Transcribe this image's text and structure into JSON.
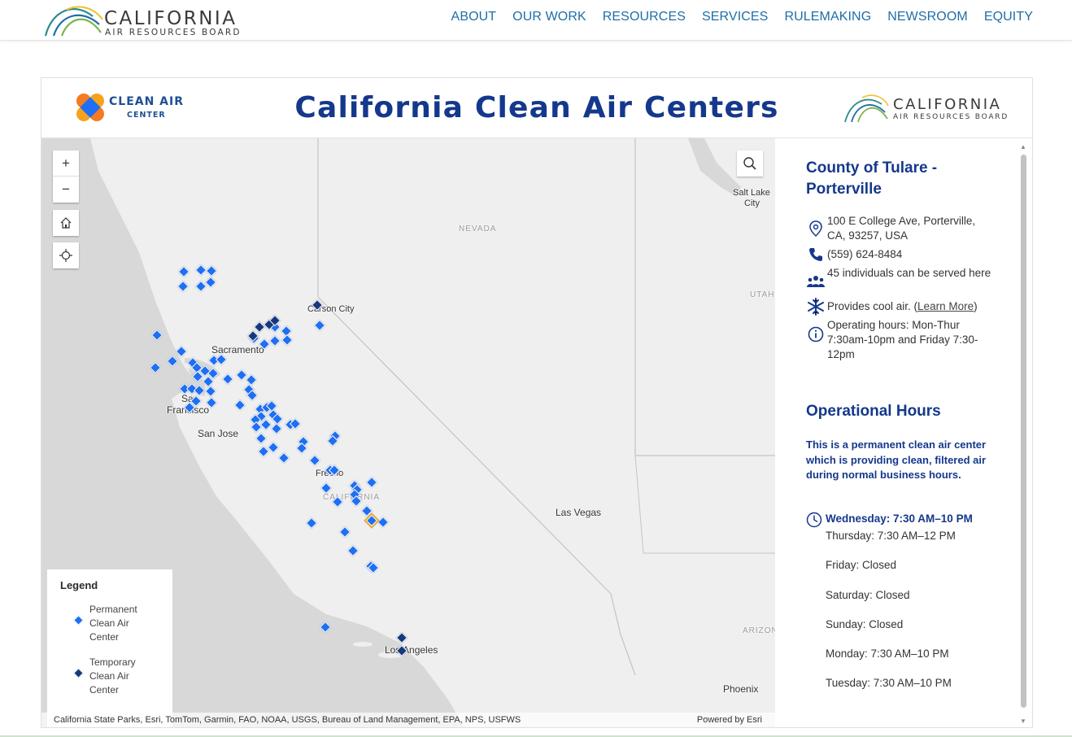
{
  "site": {
    "logo_title": "CALIFORNIA",
    "logo_sub": "AIR RESOURCES BOARD",
    "nav": [
      "ABOUT",
      "OUR WORK",
      "RESOURCES",
      "SERVICES",
      "RULEMAKING",
      "NEWSROOM",
      "EQUITY"
    ]
  },
  "app": {
    "title": "California Clean Air Centers",
    "cac_logo_line1": "CLEAN AIR",
    "cac_logo_line2": "CENTER",
    "carb_logo_title": "CALIFORNIA",
    "carb_logo_sub": "AIR RESOURCES BOARD"
  },
  "map": {
    "controls": {
      "zoom_in": "+",
      "zoom_out": "−"
    },
    "labels": {
      "nevada": "NEVADA",
      "utah": "UTAH",
      "arizona": "ARIZON",
      "california": "CALIFORNIA",
      "salt_lake": "Salt Lake",
      "salt_lake_2": "City",
      "carson_city": "Carson City",
      "sacramento": "Sacramento",
      "san": "San",
      "francisco": "Francisco",
      "san_jose": "San Jose",
      "fresno": "Fresno",
      "las_vegas": "Las Vegas",
      "los_angeles": "Los Angeles",
      "phoenix": "Phoenix"
    },
    "legend": {
      "title": "Legend",
      "permanent": "Permanent Clean Air Center",
      "temporary": "Temporary Clean Air Center"
    },
    "attribution": "California State Parks, Esri, TomTom, Garmin, FAO, NOAA, USGS, Bureau of Land Management, EPA, NPS, USFWS",
    "powered_by": "Powered by Esri",
    "colors": {
      "permanent": "#1f6ff2",
      "temporary": "#16397e",
      "selected": "#f0a830"
    }
  },
  "panel": {
    "title": "County of Tulare - Porterville",
    "address": "100 E College Ave, Porterville, CA, 93257, USA",
    "phone": "(559) 624-8484",
    "capacity": "45 individuals can be served here",
    "cool_air": "Provides cool air. (",
    "learn_more": "Learn More",
    "cool_air_close": ")",
    "op_hours_text": "Operating hours: Mon-Thur 7:30am-10pm and Friday 7:30-12pm",
    "op_title": "Operational Hours",
    "op_desc": "This is a permanent clean air center which is providing clean, filtered air during normal business hours.",
    "hours": [
      "Wednesday: 7:30 AM–10 PM",
      "Thursday: 7:30 AM–12 PM",
      "Friday: Closed",
      "Saturday: Closed",
      "Sunday: Closed",
      "Monday: 7:30 AM–10 PM",
      "Tuesday: 7:30 AM–10 PM"
    ]
  }
}
